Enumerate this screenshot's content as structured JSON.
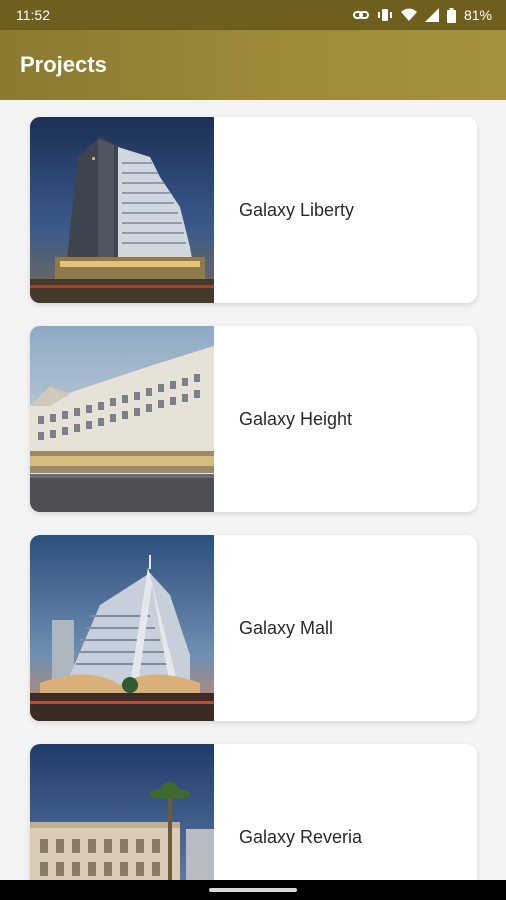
{
  "status_bar": {
    "time": "11:52",
    "battery": "81%",
    "icons": [
      "link-icon",
      "vibrate-icon",
      "wifi-icon",
      "signal-icon",
      "battery-icon"
    ]
  },
  "app_bar": {
    "title": "Projects",
    "color": "#9a8838"
  },
  "projects": [
    {
      "name": "Galaxy Liberty",
      "image": "galaxy-liberty-building-photo"
    },
    {
      "name": "Galaxy Height",
      "image": "galaxy-height-building-photo"
    },
    {
      "name": "Galaxy Mall",
      "image": "galaxy-mall-building-photo"
    },
    {
      "name": "Galaxy Reveria",
      "image": "galaxy-reveria-building-photo"
    }
  ]
}
